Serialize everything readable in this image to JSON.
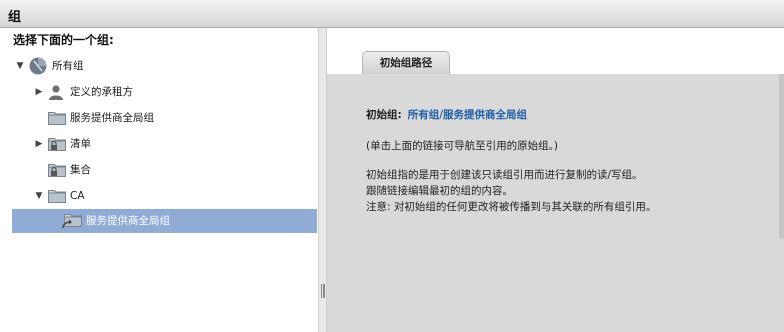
{
  "window": {
    "title": "组"
  },
  "left_panel": {
    "prompt": "选择下面的一个组:",
    "tree": [
      {
        "label": "所有组",
        "icon": "globe-icon",
        "toggle": "▼",
        "depth": 0
      },
      {
        "label": "定义的承租方",
        "icon": "person-icon",
        "toggle": "▶",
        "depth": 1
      },
      {
        "label": "服务提供商全局组",
        "icon": "folder-icon",
        "toggle": "",
        "depth": 1
      },
      {
        "label": "清单",
        "icon": "locked-folder-icon",
        "toggle": "▶",
        "depth": 1
      },
      {
        "label": "集合",
        "icon": "locked-folder-icon",
        "toggle": "",
        "depth": 1
      },
      {
        "label": "CA",
        "icon": "folder-icon",
        "toggle": "▼",
        "depth": 1
      },
      {
        "label": "服务提供商全局组",
        "icon": "linked-folder-icon",
        "toggle": "",
        "depth": 2,
        "selected": true
      }
    ]
  },
  "right_panel": {
    "tab_label": "初始组路径",
    "initial_group_label": "初始组:",
    "initial_group_link": "所有组/服务提供商全局组",
    "hint": "(单击上面的链接可导航至引用的原始组。)",
    "description": [
      "初始组指的是用于创建该只读组引用而进行复制的读/写组。",
      "跟随链接编辑最初的组的内容。",
      "注意: 对初始组的任何更改将被传播到与其关联的所有组引用。"
    ]
  },
  "colors": {
    "selection": "#8fabd6",
    "link": "#1f5fa8",
    "panel_bg": "#d9d9d9"
  }
}
